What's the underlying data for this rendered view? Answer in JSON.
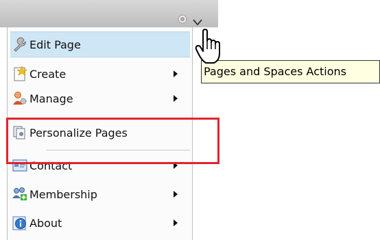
{
  "menu": {
    "items": [
      {
        "label": "Edit Page",
        "icon": "edit-page-icon",
        "has_submenu": false,
        "highlighted": true
      },
      {
        "label": "Create",
        "icon": "create-icon",
        "has_submenu": true
      },
      {
        "label": "Manage",
        "icon": "manage-icon",
        "has_submenu": true
      },
      {
        "label": "Personalize Pages",
        "icon": "personalize-pages-icon",
        "has_submenu": false
      },
      {
        "label": "Contact",
        "icon": "contact-icon",
        "has_submenu": true
      },
      {
        "label": "Membership",
        "icon": "membership-icon",
        "has_submenu": true
      },
      {
        "label": "About",
        "icon": "about-icon",
        "has_submenu": true
      }
    ]
  },
  "tooltip": {
    "text": "Pages and Spaces Actions"
  },
  "colors": {
    "highlight": "#cfe6f6",
    "annotation": "#e3222c",
    "tooltip_bg": "#ffffe1"
  }
}
